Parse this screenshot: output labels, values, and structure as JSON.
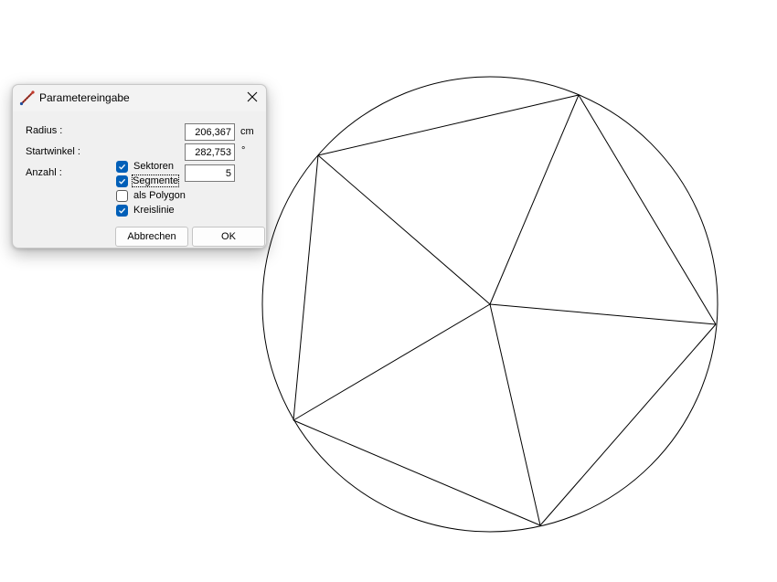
{
  "dialog": {
    "title": "Parametereingabe",
    "app_icon": "pencil-line-icon",
    "close_icon": "close-icon",
    "radius": {
      "label": "Radius :",
      "value": "206,367",
      "unit": "cm"
    },
    "startwinkel": {
      "label": "Startwinkel :",
      "value": "282,753",
      "unit": "°"
    },
    "anzahl": {
      "label": "Anzahl :",
      "value": "5"
    },
    "options": [
      {
        "label": "Sektoren",
        "checked": true
      },
      {
        "label": "Segmente",
        "checked": true
      },
      {
        "label": "als Polygon",
        "checked": false
      },
      {
        "label": "Kreislinie",
        "checked": true
      }
    ],
    "buttons": {
      "cancel": "Abbrechen",
      "ok": "OK"
    }
  },
  "drawing": {
    "shape": "circle-with-inscribed-pentagon",
    "sectors": 5,
    "start_angle_deg": 282.753,
    "stroke_color": "#000000",
    "background_color": "#ffffff"
  }
}
